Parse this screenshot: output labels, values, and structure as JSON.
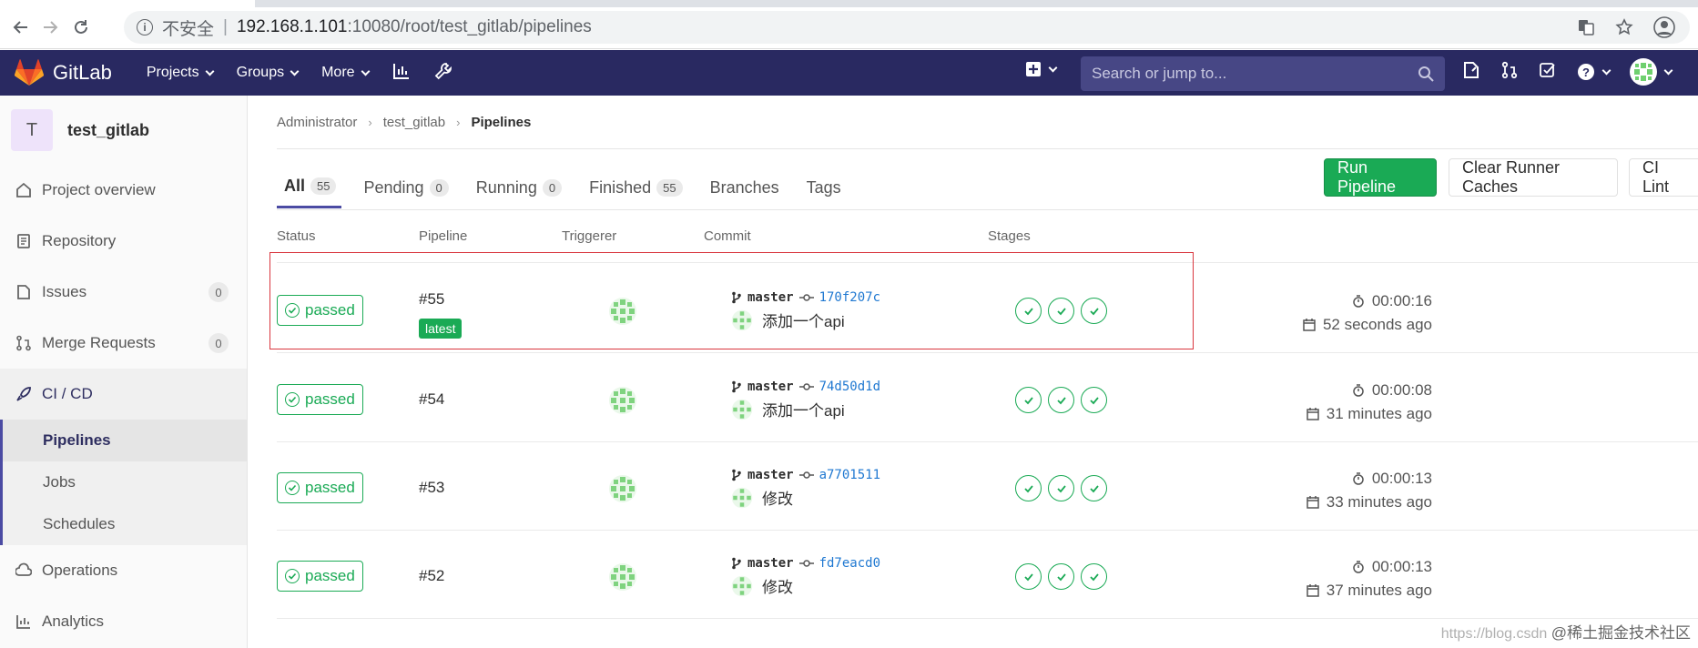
{
  "browser": {
    "insecure_label": "不安全",
    "separator": "|",
    "url_host": "192.168.1.101",
    "url_path": ":10080/root/test_gitlab/pipelines"
  },
  "header": {
    "brand": "GitLab",
    "menu": [
      "Projects",
      "Groups",
      "More"
    ],
    "search_placeholder": "Search or jump to..."
  },
  "sidebar": {
    "project_initial": "T",
    "project_name": "test_gitlab",
    "items": [
      {
        "label": "Project overview"
      },
      {
        "label": "Repository"
      },
      {
        "label": "Issues",
        "count": "0"
      },
      {
        "label": "Merge Requests",
        "count": "0"
      },
      {
        "label": "CI / CD"
      },
      {
        "label": "Operations"
      },
      {
        "label": "Analytics"
      }
    ],
    "cicd_sub": [
      "Pipelines",
      "Jobs",
      "Schedules"
    ]
  },
  "breadcrumb": [
    "Administrator",
    "test_gitlab",
    "Pipelines"
  ],
  "tabs": [
    {
      "label": "All",
      "count": "55"
    },
    {
      "label": "Pending",
      "count": "0"
    },
    {
      "label": "Running",
      "count": "0"
    },
    {
      "label": "Finished",
      "count": "55"
    },
    {
      "label": "Branches"
    },
    {
      "label": "Tags"
    }
  ],
  "buttons": {
    "run": "Run Pipeline",
    "clear": "Clear Runner Caches",
    "lint": "CI Lint"
  },
  "columns": [
    "Status",
    "Pipeline",
    "Triggerer",
    "Commit",
    "Stages"
  ],
  "pipelines": [
    {
      "status": "passed",
      "id": "#55",
      "latest": "latest",
      "branch": "master",
      "sha": "170f207c",
      "message": "添加一个api",
      "duration": "00:00:16",
      "finished": "52 seconds ago"
    },
    {
      "status": "passed",
      "id": "#54",
      "branch": "master",
      "sha": "74d50d1d",
      "message": "添加一个api",
      "duration": "00:00:08",
      "finished": "31 minutes ago"
    },
    {
      "status": "passed",
      "id": "#53",
      "branch": "master",
      "sha": "a7701511",
      "message": "修改",
      "duration": "00:00:13",
      "finished": "33 minutes ago"
    },
    {
      "status": "passed",
      "id": "#52",
      "branch": "master",
      "sha": "fd7eacd0",
      "message": "修改",
      "duration": "00:00:13",
      "finished": "37 minutes ago"
    }
  ],
  "watermark": {
    "url": "https://blog.csdn",
    "source": "@稀土掘金技术社区"
  },
  "colors": {
    "header_bg": "#292961",
    "success": "#1aaa55",
    "link": "#1f78d1",
    "highlight_box": "#d9363e"
  }
}
